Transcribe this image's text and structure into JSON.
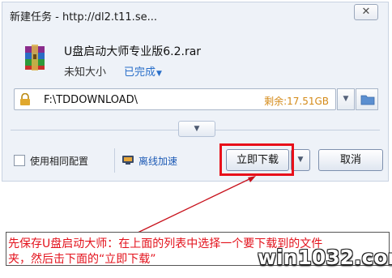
{
  "window": {
    "title": "新建任务 - http://dl2.t11.se...",
    "close_label": "✕"
  },
  "file": {
    "name": "U盘启动大师专业版6.2.rar",
    "size": "未知大小",
    "status": "已完成",
    "icon": "winrar-archive-icon"
  },
  "path": {
    "value": "F:\\TDDOWNLOAD\\",
    "free_space": "剩余:17.51GB"
  },
  "options": {
    "same_config_label": "使用相同配置",
    "same_config_checked": false,
    "offline_label": "离线加速"
  },
  "buttons": {
    "download_now": "立即下载",
    "cancel": "取消"
  },
  "annotation": {
    "line1": "先保存U盘启动大师：在上面的列表中选择一个要下载到的文件",
    "line2": "夹，然后击下面的“立即下载”",
    "color": "#e3121c"
  },
  "watermark": "win1032.com"
}
